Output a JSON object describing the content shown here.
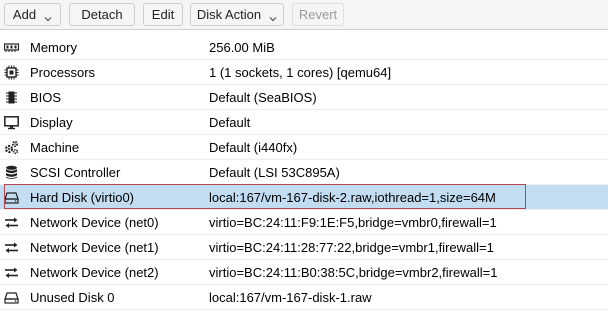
{
  "toolbar": {
    "add_label": "Add",
    "detach_label": "Detach",
    "edit_label": "Edit",
    "disk_action_label": "Disk Action",
    "revert_label": "Revert"
  },
  "rows": [
    {
      "icon": "memory-icon",
      "label": "Memory",
      "value": "256.00 MiB"
    },
    {
      "icon": "cpu-icon",
      "label": "Processors",
      "value": "1 (1 sockets, 1 cores) [qemu64]"
    },
    {
      "icon": "bios-chip-icon",
      "label": "BIOS",
      "value": "Default (SeaBIOS)"
    },
    {
      "icon": "monitor-icon",
      "label": "Display",
      "value": "Default"
    },
    {
      "icon": "gears-icon",
      "label": "Machine",
      "value": "Default (i440fx)"
    },
    {
      "icon": "database-icon",
      "label": "SCSI Controller",
      "value": "Default (LSI 53C895A)"
    },
    {
      "icon": "hard-disk-icon",
      "label": "Hard Disk (virtio0)",
      "value": "local:167/vm-167-disk-2.raw,iothread=1,size=64M",
      "selected": true
    },
    {
      "icon": "network-arrows-icon",
      "label": "Network Device (net0)",
      "value": "virtio=BC:24:11:F9:1E:F5,bridge=vmbr0,firewall=1"
    },
    {
      "icon": "network-arrows-icon",
      "label": "Network Device (net1)",
      "value": "virtio=BC:24:11:28:77:22,bridge=vmbr1,firewall=1"
    },
    {
      "icon": "network-arrows-icon",
      "label": "Network Device (net2)",
      "value": "virtio=BC:24:11:B0:38:5C,bridge=vmbr2,firewall=1"
    },
    {
      "icon": "hard-disk-icon",
      "label": "Unused Disk 0",
      "value": "local:167/vm-167-disk-1.raw"
    }
  ]
}
